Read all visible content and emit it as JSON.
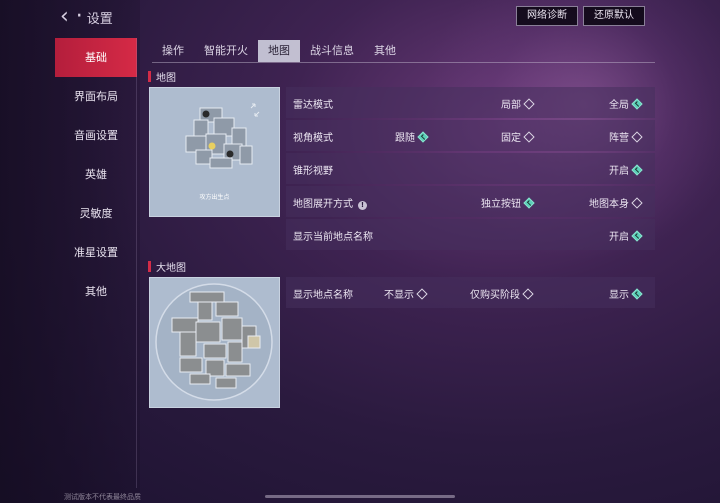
{
  "header": {
    "back_symbol": "‹ ·",
    "title": "设置",
    "network_btn": "网络诊断",
    "restore_btn": "还原默认"
  },
  "sidebar": {
    "items": [
      {
        "label": "基础",
        "active": true
      },
      {
        "label": "界面布局",
        "active": false
      },
      {
        "label": "音画设置",
        "active": false
      },
      {
        "label": "英雄",
        "active": false
      },
      {
        "label": "灵敏度",
        "active": false
      },
      {
        "label": "准星设置",
        "active": false
      },
      {
        "label": "其他",
        "active": false
      }
    ]
  },
  "tabs": [
    {
      "label": "操作",
      "active": false
    },
    {
      "label": "智能开火",
      "active": false
    },
    {
      "label": "地图",
      "active": true
    },
    {
      "label": "战斗信息",
      "active": false
    },
    {
      "label": "其他",
      "active": false
    }
  ],
  "map_section": {
    "title": "地图",
    "preview_caption": "攻方出生点",
    "rows": [
      {
        "label": "雷达模式",
        "options": [
          {
            "text": "局部",
            "checked": false
          },
          {
            "text": "全局",
            "checked": true
          }
        ]
      },
      {
        "label": "视角模式",
        "options": [
          {
            "text": "跟随",
            "checked": true
          },
          {
            "text": "固定",
            "checked": false
          },
          {
            "text": "阵营",
            "checked": false
          }
        ]
      },
      {
        "label": "锥形视野",
        "options": [
          {
            "text": "开启",
            "checked": true
          }
        ]
      },
      {
        "label": "地图展开方式",
        "info": "!",
        "options": [
          {
            "text": "独立按钮",
            "checked": true
          },
          {
            "text": "地图本身",
            "checked": false
          }
        ]
      },
      {
        "label": "显示当前地点名称",
        "options": [
          {
            "text": "开启",
            "checked": true
          }
        ]
      }
    ]
  },
  "bigmap_section": {
    "title": "大地图",
    "rows": [
      {
        "label": "显示地点名称",
        "options": [
          {
            "text": "不显示",
            "checked": false
          },
          {
            "text": "仅购买阶段",
            "checked": false
          },
          {
            "text": "显示",
            "checked": true
          }
        ]
      }
    ]
  },
  "footer": {
    "note": "测试版本不代表最终品质"
  },
  "colors": {
    "accent_red": "#d42c48",
    "check_teal": "#5ad0b8"
  }
}
